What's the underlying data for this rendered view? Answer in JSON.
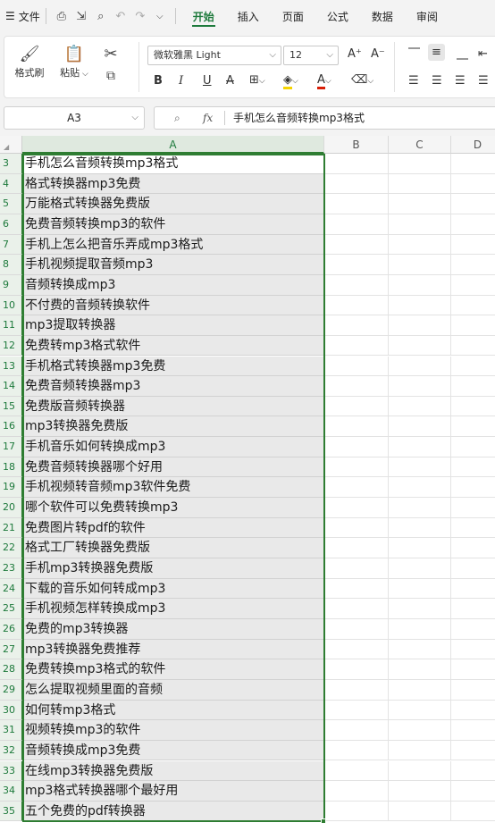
{
  "menubar": {
    "hamburger": "☰",
    "file_label": "文件",
    "tabs": [
      "开始",
      "插入",
      "页面",
      "公式",
      "数据",
      "审阅"
    ],
    "active_tab": "开始"
  },
  "ribbon": {
    "format_painter": "格式刷",
    "paste": "粘贴",
    "font_name": "微软雅黑 Light",
    "font_size": "12",
    "bold": "B",
    "italic": "I",
    "underline": "U",
    "strike": "A",
    "grow_font": "A⁺",
    "shrink_font": "A⁻",
    "font_color_letter": "A",
    "fill_color": "#f5d400",
    "font_color": "#d81e06"
  },
  "formula_bar": {
    "cell_ref": "A3",
    "fx": "fx",
    "content": "手机怎么音频转换mp3格式"
  },
  "columns": [
    "A",
    "B",
    "C",
    "D"
  ],
  "selected_column": "A",
  "rows": [
    {
      "n": "3",
      "a": "手机怎么音频转换mp3格式"
    },
    {
      "n": "4",
      "a": "格式转换器mp3免费"
    },
    {
      "n": "5",
      "a": "万能格式转换器免费版"
    },
    {
      "n": "6",
      "a": "免费音频转换mp3的软件"
    },
    {
      "n": "7",
      "a": "手机上怎么把音乐弄成mp3格式"
    },
    {
      "n": "8",
      "a": "手机视频提取音频mp3"
    },
    {
      "n": "9",
      "a": "音频转换成mp3"
    },
    {
      "n": "10",
      "a": "不付费的音频转换软件"
    },
    {
      "n": "11",
      "a": "mp3提取转换器"
    },
    {
      "n": "12",
      "a": "免费转mp3格式软件"
    },
    {
      "n": "13",
      "a": "手机格式转换器mp3免费"
    },
    {
      "n": "14",
      "a": "免费音频转换器mp3"
    },
    {
      "n": "15",
      "a": "免费版音频转换器"
    },
    {
      "n": "16",
      "a": "mp3转换器免费版"
    },
    {
      "n": "17",
      "a": "手机音乐如何转换成mp3"
    },
    {
      "n": "18",
      "a": "免费音频转换器哪个好用"
    },
    {
      "n": "19",
      "a": "手机视频转音频mp3软件免费"
    },
    {
      "n": "20",
      "a": "哪个软件可以免费转换mp3"
    },
    {
      "n": "21",
      "a": "免费图片转pdf的软件"
    },
    {
      "n": "22",
      "a": "格式工厂转换器免费版"
    },
    {
      "n": "23",
      "a": "手机mp3转换器免费版"
    },
    {
      "n": "24",
      "a": "下载的音乐如何转成mp3"
    },
    {
      "n": "25",
      "a": "手机视频怎样转换成mp3"
    },
    {
      "n": "26",
      "a": "免费的mp3转换器"
    },
    {
      "n": "27",
      "a": "mp3转换器免费推荐"
    },
    {
      "n": "28",
      "a": "免费转换mp3格式的软件"
    },
    {
      "n": "29",
      "a": "怎么提取视频里面的音频"
    },
    {
      "n": "30",
      "a": "如何转mp3格式"
    },
    {
      "n": "31",
      "a": "视频转换mp3的软件"
    },
    {
      "n": "32",
      "a": "音频转换成mp3免费"
    },
    {
      "n": "33",
      "a": "在线mp3转换器免费版"
    },
    {
      "n": "34",
      "a": "mp3格式转换器哪个最好用"
    },
    {
      "n": "35",
      "a": "五个免费的pdf转换器"
    }
  ],
  "colors": {
    "accent": "#1e7a3c",
    "selection_border": "#2e7d32"
  }
}
